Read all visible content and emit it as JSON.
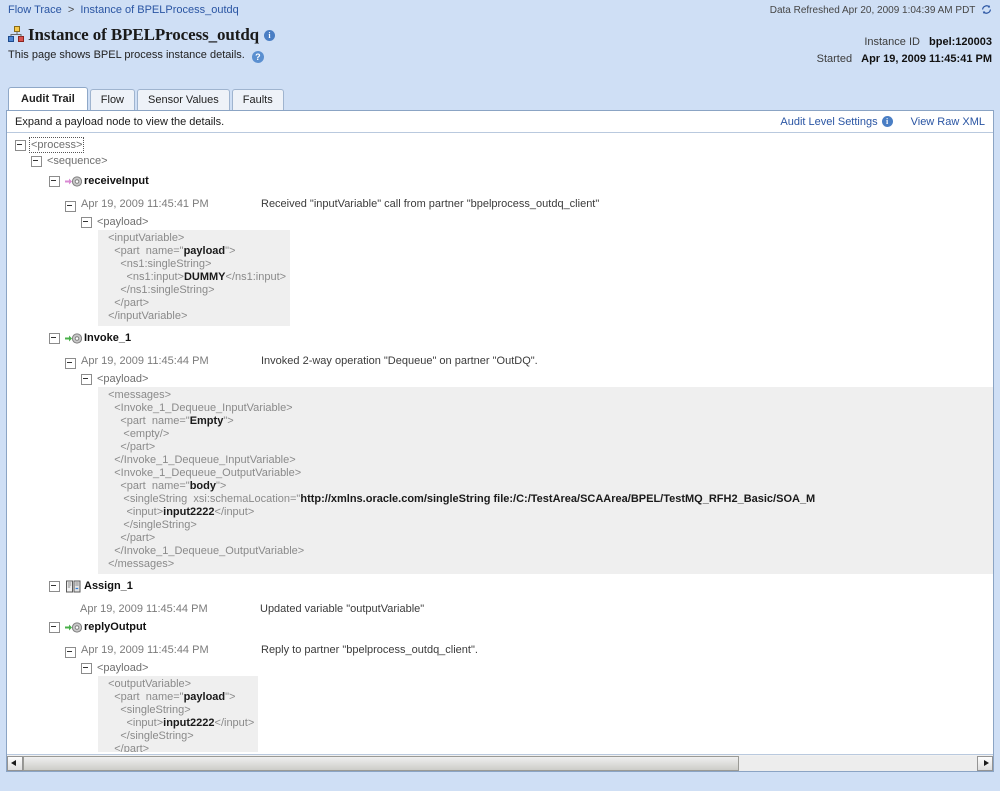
{
  "breadcrumb": {
    "items": [
      {
        "label": "Flow Trace",
        "link": true
      },
      {
        "label": "Instance of BPELProcess_outdq",
        "link": false
      }
    ],
    "separator": ">"
  },
  "header": {
    "refresh_text": "Data Refreshed Apr 20, 2009 1:04:39 AM PDT",
    "refresh_icon": "refresh-icon",
    "title": "Instance of BPELProcess_outdq",
    "title_icon": "bpel-instance-icon",
    "title_info_icon": "info-icon",
    "subtitle": "This page shows BPEL process instance details.",
    "help_icon": "help-icon",
    "meta": [
      {
        "label": "Instance ID",
        "value": "bpel:120003"
      },
      {
        "label": "Started",
        "value": "Apr 19, 2009 11:45:41 PM"
      }
    ]
  },
  "tabs": [
    {
      "label": "Audit Trail",
      "active": true
    },
    {
      "label": "Flow",
      "active": false
    },
    {
      "label": "Sensor Values",
      "active": false
    },
    {
      "label": "Faults",
      "active": false
    }
  ],
  "panel": {
    "hint": "Expand a payload node to view the details.",
    "links": [
      {
        "label": "Audit Level Settings",
        "icon": "info-icon"
      },
      {
        "label": "View Raw XML",
        "icon": null
      }
    ]
  },
  "tree": {
    "process_tag": "<process>",
    "sequence_tag": "<sequence>",
    "payload_tag": "<payload>",
    "activities": [
      {
        "name": "receiveInput",
        "icon": "receive-activity-icon",
        "time": "Apr 19, 2009 11:45:41 PM",
        "message": "Received \"inputVariable\" call from partner \"bpelprocess_outdq_client\"",
        "payload": "  <inputVariable>\n    <part  name=\"payload\">\n      <ns1:singleString>\n        <ns1:input>DUMMY</ns1:input>\n      </ns1:singleString>\n    </part>\n  </inputVariable>"
      },
      {
        "name": "Invoke_1",
        "icon": "invoke-activity-icon",
        "time": "Apr 19, 2009 11:45:44 PM",
        "message": "Invoked 2-way operation \"Dequeue\" on partner \"OutDQ\".",
        "payload": "  <messages>\n    <Invoke_1_Dequeue_InputVariable>\n      <part  name=\"Empty\">\n       <empty/>\n      </part>\n    </Invoke_1_Dequeue_InputVariable>\n    <Invoke_1_Dequeue_OutputVariable>\n      <part  name=\"body\">\n       <singleString  xsi:schemaLocation=\"http://xmlns.oracle.com/singleString file:/C:/TestArea/SCAArea/BPEL/TestMQ_RFH2_Basic/SOA_M\n        <input>input2222</input>\n       </singleString>\n      </part>\n    </Invoke_1_Dequeue_OutputVariable>\n  </messages>"
      },
      {
        "name": "Assign_1",
        "icon": "assign-activity-icon",
        "time": "Apr 19, 2009 11:45:44 PM",
        "message": "Updated variable \"outputVariable\"",
        "payload": null
      },
      {
        "name": "replyOutput",
        "icon": "reply-activity-icon",
        "time": "Apr 19, 2009 11:45:44 PM",
        "message": "Reply to partner \"bpelprocess_outdq_client\".",
        "payload": "  <outputVariable>\n    <part  name=\"payload\">\n      <singleString>\n        <input>input2222</input>\n      </singleString>\n    </part>\n  </outputVariable>"
      }
    ]
  },
  "scrollbar": {
    "left_arrow_icon": "arrow-left-icon",
    "right_arrow_icon": "arrow-right-icon",
    "thumb_fraction": "75%"
  }
}
